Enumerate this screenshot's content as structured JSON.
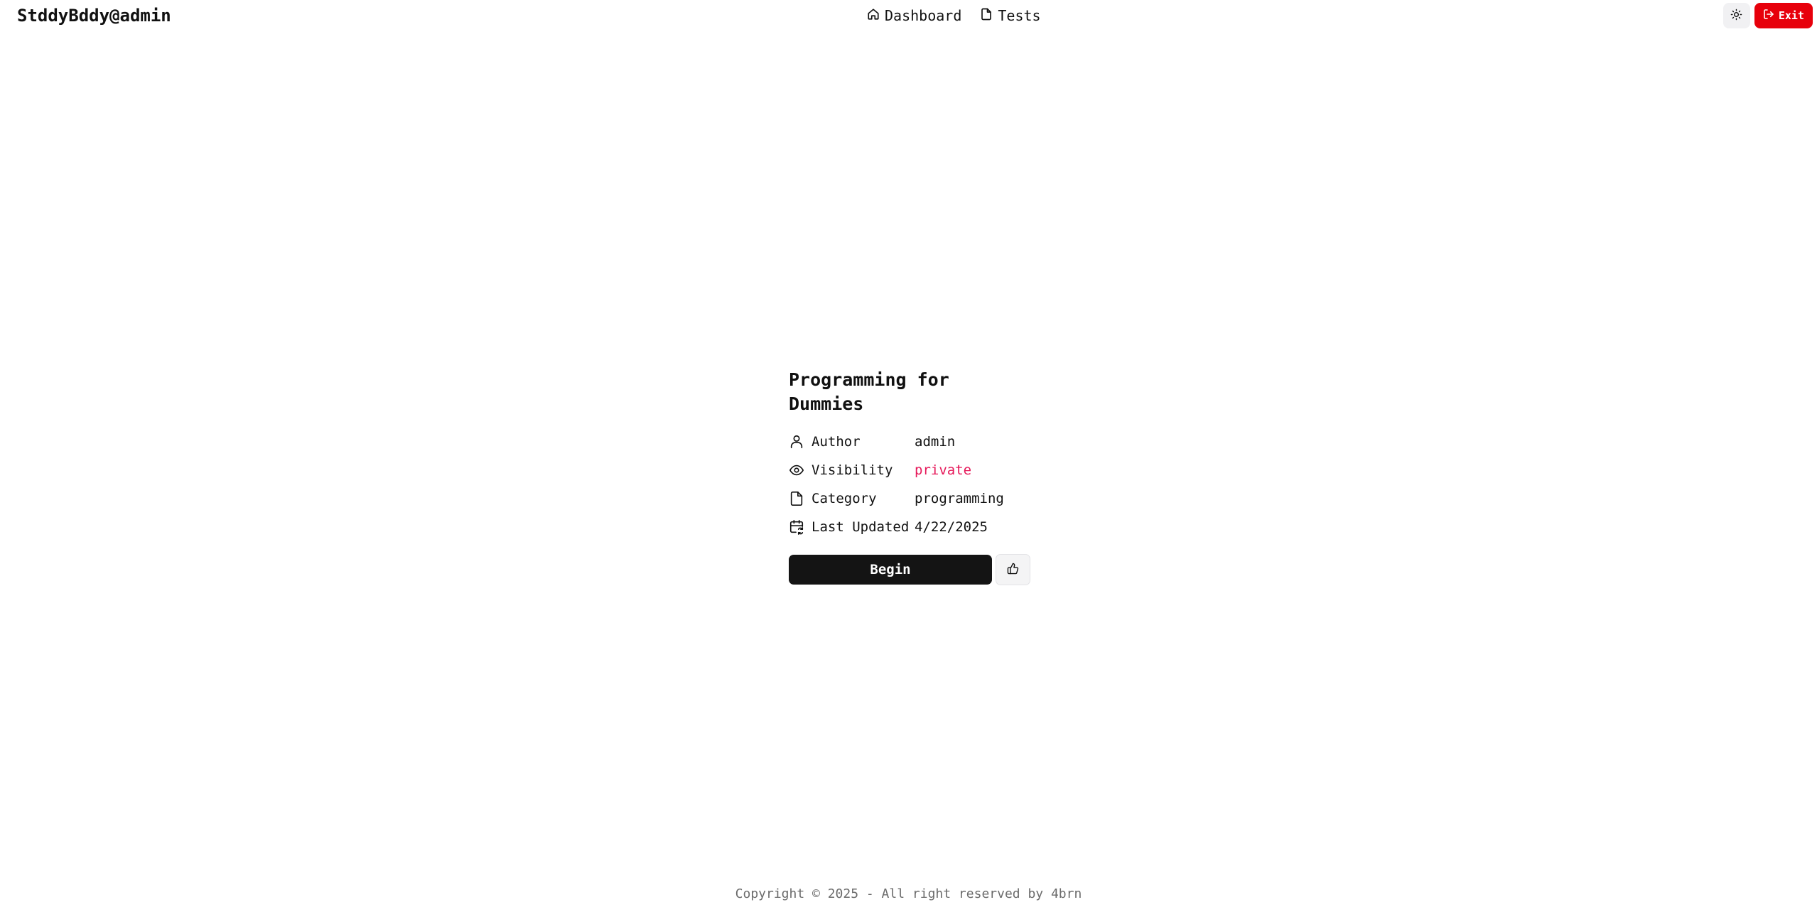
{
  "header": {
    "brand": "StddyBddy@admin",
    "nav": [
      {
        "label": "Dashboard",
        "icon": "home-icon"
      },
      {
        "label": "Tests",
        "icon": "file-icon"
      }
    ],
    "theme_toggle_icon": "sun-icon",
    "exit_label": "Exit",
    "exit_icon": "log-out-icon",
    "exit_color": "#e7000b"
  },
  "test": {
    "title": "Programming for Dummies",
    "meta": [
      {
        "label": "Author",
        "value": "admin",
        "icon": "user-icon"
      },
      {
        "label": "Visibility",
        "value": "private",
        "icon": "eye-icon",
        "color": "#e6195a"
      },
      {
        "label": "Category",
        "value": "programming",
        "icon": "file-icon"
      },
      {
        "label": "Last Updated",
        "value": "4/22/2025",
        "icon": "calendar-sync-icon"
      }
    ],
    "begin_label": "Begin",
    "like_icon": "thumbs-up-icon"
  },
  "footer": {
    "copyright": "Copyright © 2025 - All right reserved by 4brn"
  }
}
